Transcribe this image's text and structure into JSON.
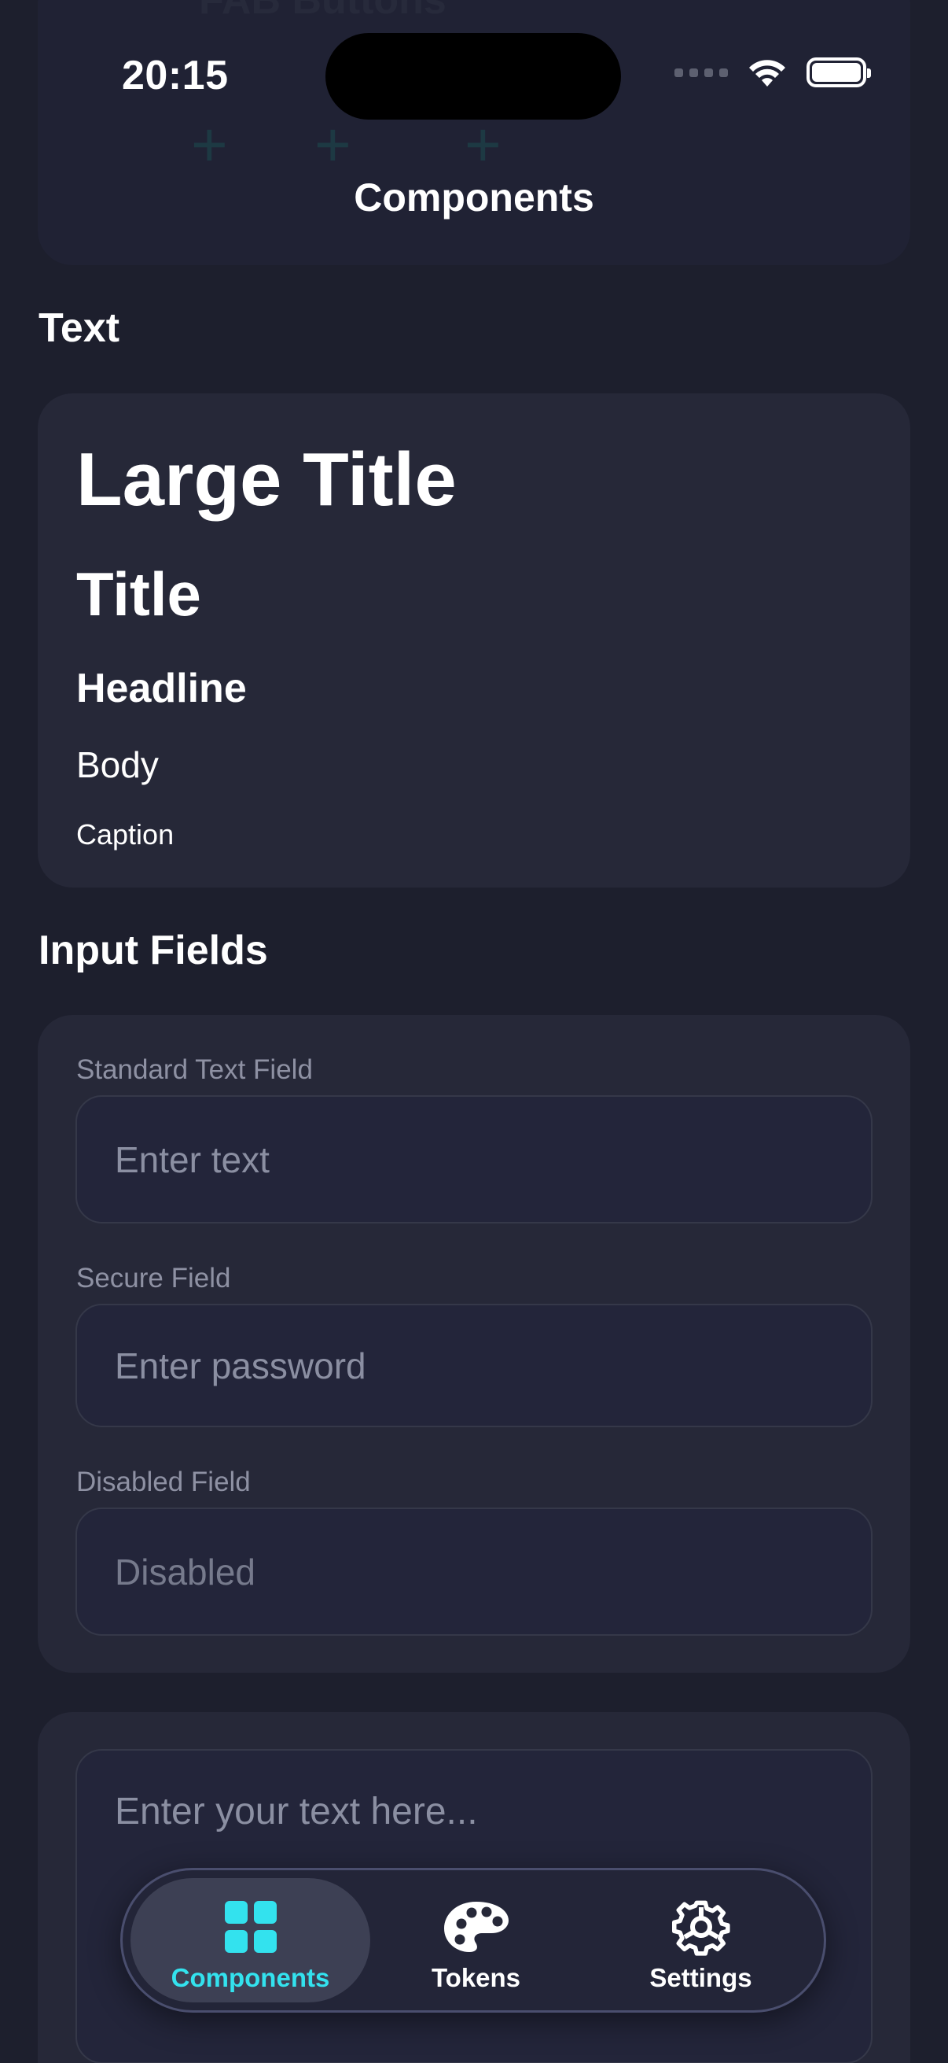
{
  "status_bar": {
    "time": "20:15"
  },
  "ghost": {
    "title": "FAB Buttons",
    "fab_glyph": "+"
  },
  "nav": {
    "title": "Components"
  },
  "text_section": {
    "title": "Text",
    "large_title": "Large Title",
    "title_sample": "Title",
    "headline": "Headline",
    "body": "Body",
    "caption": "Caption"
  },
  "input_section": {
    "title": "Input Fields",
    "standard": {
      "label": "Standard Text Field",
      "placeholder": "Enter text"
    },
    "secure": {
      "label": "Secure Field",
      "placeholder": "Enter password"
    },
    "disabled": {
      "label": "Disabled Field",
      "placeholder": "Disabled"
    }
  },
  "text_area": {
    "placeholder": "Enter your text here..."
  },
  "tabbar": {
    "tabs": [
      {
        "label": "Components",
        "icon": "grid-icon",
        "active": true
      },
      {
        "label": "Tokens",
        "icon": "palette-icon",
        "active": false
      },
      {
        "label": "Settings",
        "icon": "gear-icon",
        "active": false
      }
    ]
  },
  "colors": {
    "background": "#1d1f2d",
    "card": "#262838",
    "accent": "#33e2ee"
  }
}
